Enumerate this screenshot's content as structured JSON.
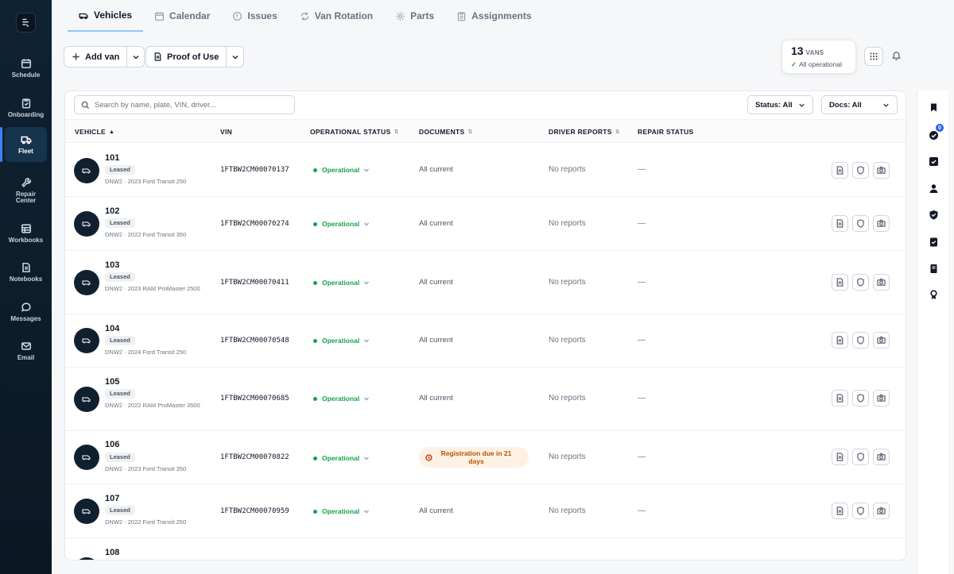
{
  "sidebar": {
    "items": [
      {
        "label": "Schedule",
        "icon": "calendar-icon"
      },
      {
        "label": "Onboarding",
        "icon": "clipboard-icon"
      },
      {
        "label": "Fleet",
        "icon": "truck-icon"
      },
      {
        "label": "Repair Center",
        "icon": "wrench-icon"
      },
      {
        "label": "Workbooks",
        "icon": "table-icon"
      },
      {
        "label": "Notebooks",
        "icon": "notebook-icon"
      },
      {
        "label": "Messages",
        "icon": "chat-bubble-icon"
      },
      {
        "label": "Email",
        "icon": "mail-icon"
      }
    ],
    "active": "Fleet"
  },
  "tabs": [
    {
      "label": "Vehicles",
      "icon": "van-icon"
    },
    {
      "label": "Calendar",
      "icon": "calendar-icon"
    },
    {
      "label": "Issues",
      "icon": "alert-circle-icon"
    },
    {
      "label": "Van Rotation",
      "icon": "refresh-icon"
    },
    {
      "label": "Parts",
      "icon": "gear-icon"
    },
    {
      "label": "Assignments",
      "icon": "clipboard-icon"
    }
  ],
  "active_tab": "Vehicles",
  "toolbar": {
    "add_van_label": "Add van",
    "proof_of_use_label": "Proof of Use"
  },
  "summary": {
    "count": "13",
    "unit": "VANS",
    "status": "All operational"
  },
  "search": {
    "placeholder": "Search by name, plate, VIN, driver..."
  },
  "filters": {
    "status": "Status: All",
    "docs": "Docs: All"
  },
  "table": {
    "columns": [
      "VEHICLE",
      "VIN",
      "OPERATIONAL STATUS",
      "DOCUMENTS",
      "DRIVER REPORTS",
      "REPAIR STATUS"
    ],
    "sort_column": "VEHICLE",
    "rows": [
      {
        "number": "101",
        "ownership": "Leased",
        "details": "DNW2 · 2023 Ford Transit 250",
        "vin": "1FTBW2CM00070137",
        "status": "Operational",
        "documents": "All current",
        "documents_warning": false,
        "reports": "No reports",
        "repair": "—"
      },
      {
        "number": "102",
        "ownership": "Leased",
        "details": "DNW2 · 2022 Ford Transit 350",
        "vin": "1FTBW2CM00070274",
        "status": "Operational",
        "documents": "All current",
        "documents_warning": false,
        "reports": "No reports",
        "repair": "—"
      },
      {
        "number": "103",
        "ownership": "Leased",
        "details": "DNW2 · 2023 RAM ProMaster 2500",
        "vin": "1FTBW2CM00070411",
        "status": "Operational",
        "documents": "All current",
        "documents_warning": false,
        "reports": "No reports",
        "repair": "—"
      },
      {
        "number": "104",
        "ownership": "Leased",
        "details": "DNW2 · 2024 Ford Transit 250",
        "vin": "1FTBW2CM00070548",
        "status": "Operational",
        "documents": "All current",
        "documents_warning": false,
        "reports": "No reports",
        "repair": "—"
      },
      {
        "number": "105",
        "ownership": "Leased",
        "details": "DNW2 · 2022 RAM ProMaster 3500",
        "vin": "1FTBW2CM00070685",
        "status": "Operational",
        "documents": "All current",
        "documents_warning": false,
        "reports": "No reports",
        "repair": "—"
      },
      {
        "number": "106",
        "ownership": "Leased",
        "details": "DNW2 · 2023 Ford Transit 350",
        "vin": "1FTBW2CM00070822",
        "status": "Operational",
        "documents": "Registration due in 21 days",
        "documents_warning": true,
        "reports": "No reports",
        "repair": "—"
      },
      {
        "number": "107",
        "ownership": "Leased",
        "details": "DNW2 · 2022 Ford Transit 250",
        "vin": "1FTBW2CM00070959",
        "status": "Operational",
        "documents": "All current",
        "documents_warning": false,
        "reports": "No reports",
        "repair": "—"
      },
      {
        "number": "108",
        "ownership": "",
        "details": "",
        "vin": "",
        "status": "",
        "documents": "",
        "documents_warning": false,
        "reports": "",
        "repair": ""
      }
    ]
  },
  "right_rail": {
    "icons": [
      "bookmark-icon",
      "check-circle-icon",
      "check-square-icon",
      "user-icon",
      "shield-check-icon",
      "clipboard-check-icon",
      "book-icon",
      "award-icon"
    ],
    "badge_count": "0"
  },
  "colors": {
    "sidebar_bg": "#0f2233",
    "accent": "#2563eb",
    "operational": "#16a34a",
    "warning_bg": "#fdf1e3",
    "warning_text": "#b45309"
  }
}
